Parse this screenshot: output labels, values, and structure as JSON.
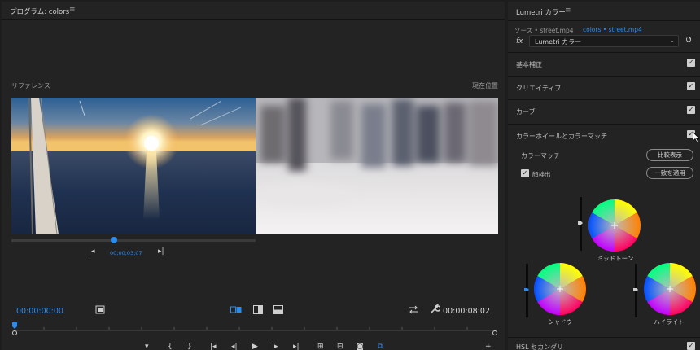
{
  "program": {
    "title": "プログラム: colors",
    "menu_icon": "hamburger-icon",
    "reference_label": "リファレンス",
    "current_label": "現在位置",
    "reference_timecode": "00;00;03;07",
    "reference_playhead_fraction": 0.42,
    "timecode_current": "00:00:00:00",
    "timecode_duration": "00:00:08:02"
  },
  "lumetri": {
    "title": "Lumetri カラー",
    "menu_icon": "hamburger-icon",
    "source_label": "ソース • street.mp4",
    "clip_label": "colors • street.mp4",
    "fx_label": "fx",
    "effect_name": "Lumetri カラー",
    "sections": [
      {
        "label": "基本補正",
        "checked": true
      },
      {
        "label": "クリエイティブ",
        "checked": true
      },
      {
        "label": "カーブ",
        "checked": true
      },
      {
        "label": "カラーホイールとカラーマッチ",
        "checked": true
      }
    ],
    "color_match": {
      "label": "カラーマッチ",
      "compare_button": "比較表示",
      "face_detect_label": "顔検出",
      "face_detect_checked": true,
      "apply_button": "一致を適用"
    },
    "wheels": {
      "midtone": "ミッドトーン",
      "shadow": "シャドウ",
      "highlight": "ハイライト"
    },
    "hsl_label": "HSL セカンダリ",
    "hsl_checked": true
  },
  "colors": {
    "accent": "#2d8ceb",
    "panel_bg": "#232323",
    "app_bg": "#1d1d1d"
  }
}
